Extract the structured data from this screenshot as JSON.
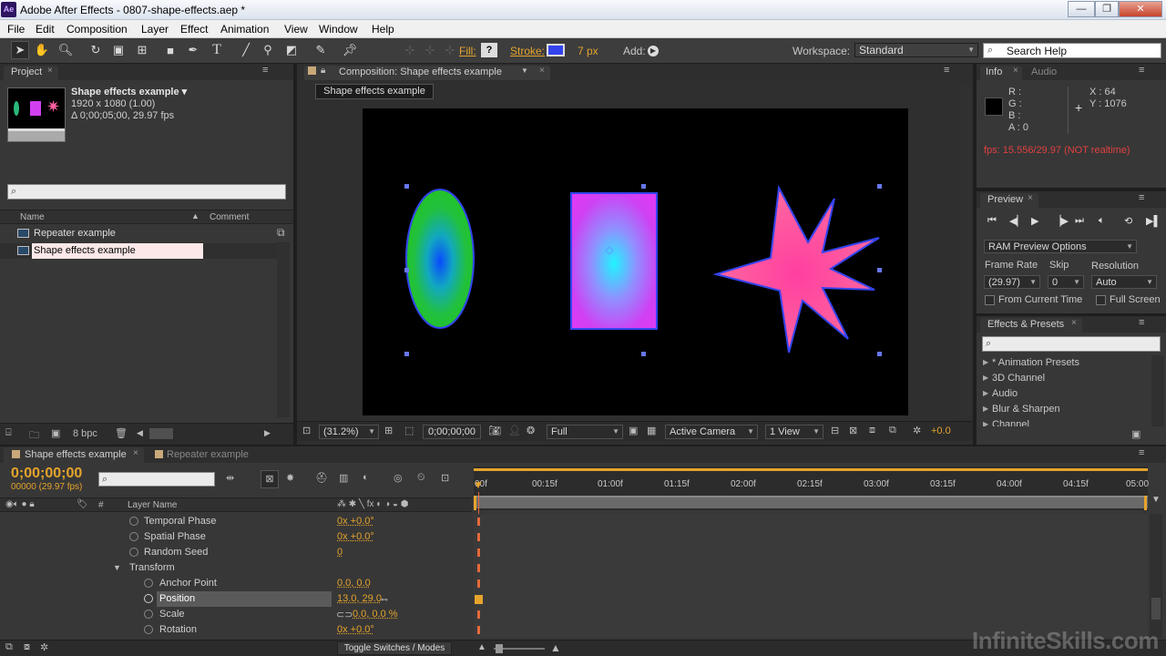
{
  "window": {
    "title": "Adobe After Effects - 0807-shape-effects.aep *",
    "app_icon": "Ae",
    "min": "—",
    "max": "❐",
    "close": "✕"
  },
  "menu": [
    "File",
    "Edit",
    "Composition",
    "Layer",
    "Effect",
    "Animation",
    "View",
    "Window",
    "Help"
  ],
  "toolbar": {
    "fill_label": "Fill:",
    "fill_value": "?",
    "stroke_label": "Stroke:",
    "stroke_width": "7 px",
    "add_label": "Add:",
    "workspace_label": "Workspace:",
    "workspace_value": "Standard",
    "search_placeholder": "Search Help"
  },
  "project": {
    "tab": "Project",
    "comp_name": "Shape effects example ▾",
    "comp_size": "1920 x 1080 (1.00)",
    "comp_duration": "Δ 0;00;05;00, 29.97 fps",
    "col_name": "Name",
    "col_comment": "Comment",
    "items": [
      "Repeater example",
      "Shape effects example"
    ],
    "bpc": "8 bpc"
  },
  "comp": {
    "tab": "Composition: Shape effects example",
    "breadcrumb": "Shape effects example",
    "zoom": "(31.2%)",
    "timecode": "0;00;00;00",
    "resolution": "Full",
    "camera": "Active Camera",
    "view": "1 View",
    "exposure": "+0.0"
  },
  "info": {
    "tab_info": "Info",
    "tab_audio": "Audio",
    "r": "R :",
    "g": "G :",
    "b": "B :",
    "a": "A : 0",
    "x": "X : 64",
    "y": "Y : 1076",
    "fps": "fps: 15.556/29.97 (NOT realtime)"
  },
  "preview": {
    "tab": "Preview",
    "ram_options": "RAM Preview Options",
    "frame_rate_label": "Frame Rate",
    "skip_label": "Skip",
    "resolution_label": "Resolution",
    "frame_rate": "(29.97)",
    "skip": "0",
    "resolution": "Auto",
    "from_current": "From Current Time",
    "full_screen": "Full Screen"
  },
  "effects": {
    "tab": "Effects & Presets",
    "items": [
      "* Animation Presets",
      "3D Channel",
      "Audio",
      "Blur & Sharpen",
      "Channel"
    ]
  },
  "timeline": {
    "tab_active": "Shape effects example",
    "tab_other": "Repeater example",
    "timecode": "0;00;00;00",
    "frame_info": "00000 (29.97 fps)",
    "layer_name_header": "Layer Name",
    "hash": "#",
    "ruler": [
      "00f",
      "00:15f",
      "01:00f",
      "01:15f",
      "02:00f",
      "02:15f",
      "03:00f",
      "03:15f",
      "04:00f",
      "04:15f",
      "05:00"
    ],
    "properties": [
      {
        "name": "Temporal Phase",
        "value": "0x +0.0°"
      },
      {
        "name": "Spatial Phase",
        "value": "0x +0.0°"
      },
      {
        "name": "Random Seed",
        "value": "0"
      },
      {
        "name": "Transform",
        "value": ""
      },
      {
        "name": "Anchor Point",
        "value": "0.0, 0.0"
      },
      {
        "name": "Position",
        "value": "13.0, 29.0"
      },
      {
        "name": "Scale",
        "value": "0.0, 0.0 %"
      },
      {
        "name": "Rotation",
        "value": "0x +0.0°"
      }
    ],
    "toggle_label": "Toggle Switches / Modes"
  },
  "watermark": "InfiniteSkills.com",
  "colors": {
    "accent": "#e5a42c",
    "fps_warning": "#e04040",
    "shape_stroke": "#3344ee"
  }
}
